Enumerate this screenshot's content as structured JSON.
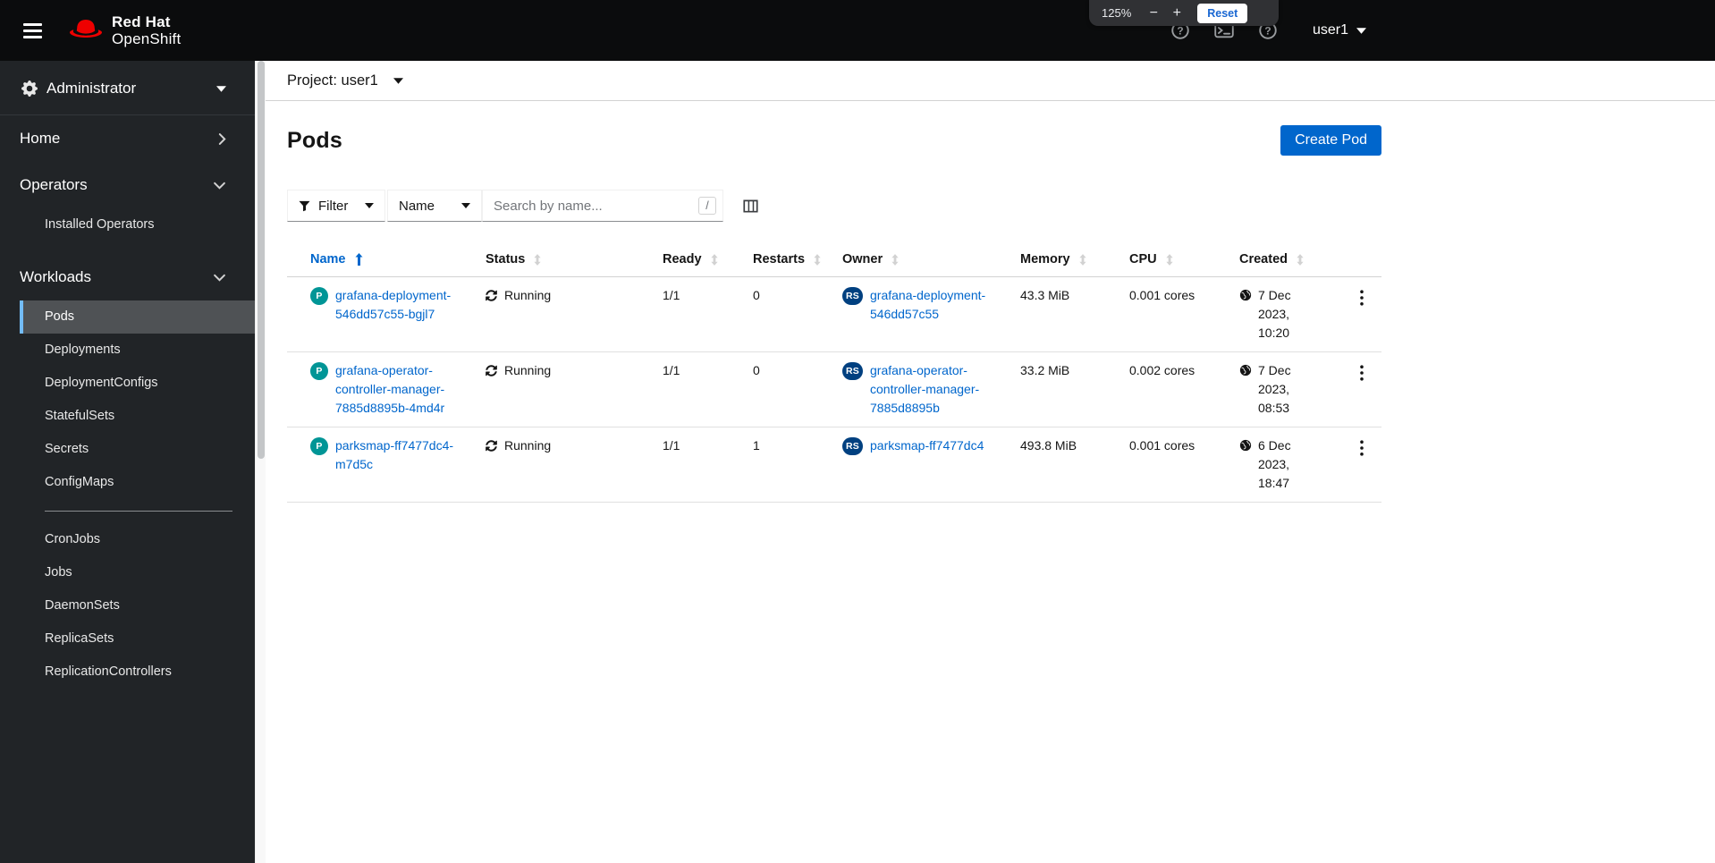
{
  "masthead": {
    "brand_line1": "Red Hat",
    "brand_line2": "OpenShift",
    "user": "user1"
  },
  "zoom_overlay": {
    "level": "125%",
    "minus": "−",
    "plus": "+",
    "reset_label": "Reset"
  },
  "sidebar": {
    "perspective_label": "Administrator",
    "sections": {
      "home": "Home",
      "operators": "Operators",
      "workloads": "Workloads"
    },
    "operators_items": [
      {
        "label": "Installed Operators"
      }
    ],
    "workloads_items": [
      {
        "label": "Pods",
        "selected": true
      },
      {
        "label": "Deployments"
      },
      {
        "label": "DeploymentConfigs"
      },
      {
        "label": "StatefulSets"
      },
      {
        "label": "Secrets"
      },
      {
        "label": "ConfigMaps"
      },
      {
        "label": "CronJobs"
      },
      {
        "label": "Jobs"
      },
      {
        "label": "DaemonSets"
      },
      {
        "label": "ReplicaSets"
      },
      {
        "label": "ReplicationControllers"
      }
    ]
  },
  "project_bar": {
    "label": "Project: user1"
  },
  "page": {
    "title": "Pods",
    "create_button_label": "Create Pod"
  },
  "toolbar": {
    "filter_label": "Filter",
    "attribute_label": "Name",
    "search_placeholder": "Search by name...",
    "search_shortcut": "/"
  },
  "table": {
    "columns": [
      "Name",
      "Status",
      "Ready",
      "Restarts",
      "Owner",
      "Memory",
      "CPU",
      "Created"
    ],
    "sorted_by": "Name",
    "sort_direction": "ascending",
    "rows": [
      {
        "badge": "P",
        "name": "grafana-deployment-546dd57c55-bgjl7",
        "status": "Running",
        "ready": "1/1",
        "restarts": "0",
        "owner_badge": "RS",
        "owner": "grafana-deployment-546dd57c55",
        "memory": "43.3 MiB",
        "cpu": "0.001 cores",
        "created_date": "7 Dec 2023,",
        "created_time": "10:20"
      },
      {
        "badge": "P",
        "name": "grafana-operator-controller-manager-7885d8895b-4md4r",
        "status": "Running",
        "ready": "1/1",
        "restarts": "0",
        "owner_badge": "RS",
        "owner": "grafana-operator-controller-manager-7885d8895b",
        "memory": "33.2 MiB",
        "cpu": "0.002 cores",
        "created_date": "7 Dec 2023,",
        "created_time": "08:53"
      },
      {
        "badge": "P",
        "name": "parksmap-ff7477dc4-m7d5c",
        "status": "Running",
        "ready": "1/1",
        "restarts": "1",
        "owner_badge": "RS",
        "owner": "parksmap-ff7477dc4",
        "memory": "493.8 MiB",
        "cpu": "0.001 cores",
        "created_date": "6 Dec 2023,",
        "created_time": "18:47"
      }
    ]
  },
  "colors": {
    "accent_blue": "#0066cc",
    "brand_red": "#ee0000",
    "pod_badge": "#009596",
    "replicaset_badge": "#004080",
    "masthead_bg": "#0b0c0d",
    "sidebar_bg": "#212427",
    "sidebar_selected_bg": "#4f5255",
    "sidebar_selected_accent": "#73bcf7"
  }
}
